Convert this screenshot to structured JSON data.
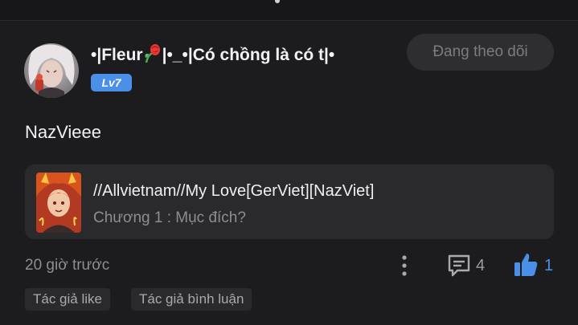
{
  "post": {
    "author": {
      "name_prefix": "•|Fleur",
      "name_suffix": "|•_•|Có chồng là có t|•",
      "level": "Lv7"
    },
    "follow_label": "Đang theo dõi",
    "text": "NazVieee",
    "story": {
      "title": "//Allvietnam//My Love[GerViet][NazViet]",
      "chapter": "Chương 1 : Mục đích?"
    },
    "time": "20 giờ trước",
    "comment_count": "4",
    "like_count": "1",
    "tags": [
      "Tác giả like",
      "Tác giả bình luận"
    ]
  },
  "colors": {
    "background": "#1c1c1e",
    "accent": "#4a8fe8",
    "card": "#2a2a2d"
  },
  "icons": {
    "more": "more-vertical-icon",
    "comment": "comment-icon",
    "like": "thumbs-up-icon",
    "flower": "rose-emoji-icon"
  }
}
